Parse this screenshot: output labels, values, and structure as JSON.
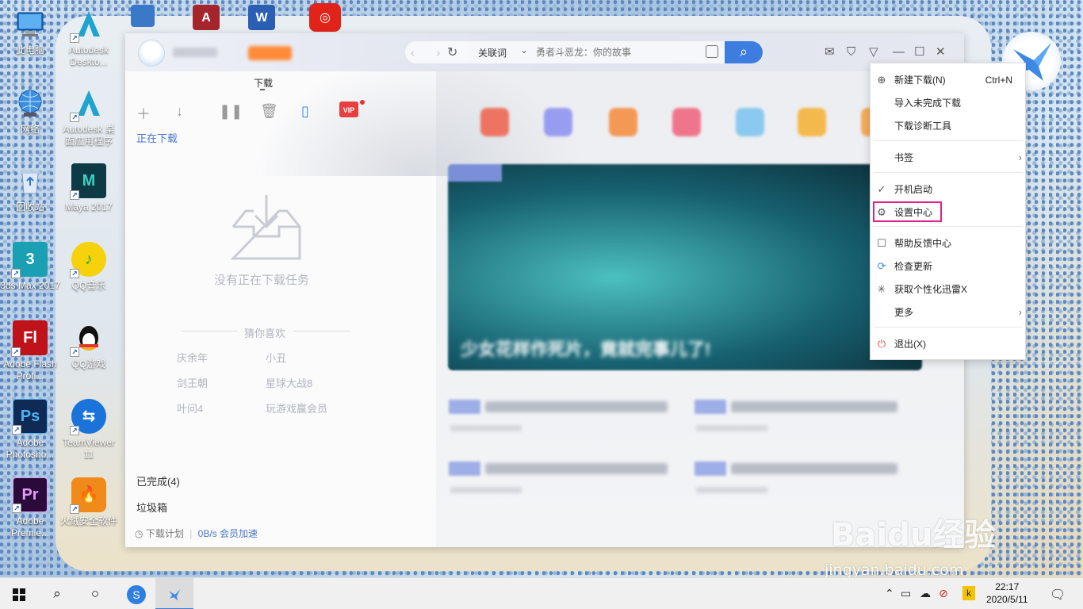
{
  "desktop": {
    "icons": [
      {
        "label": "此电脑",
        "icon": "computer-icon",
        "color": "#3c8ad8"
      },
      {
        "label": "Autodesk Deskto...",
        "icon": "autodesk-icon",
        "color": "#1f8fc0"
      },
      {
        "label": "网络",
        "icon": "network-icon",
        "color": "#3c8ad8"
      },
      {
        "label": "Autodesk 桌面应用程序",
        "icon": "autodesk-icon",
        "color": "#1f8fc0"
      },
      {
        "label": "回收站",
        "icon": "recycle-bin-icon",
        "color": "#6aa0d8"
      },
      {
        "label": "Maya 2017",
        "icon": "maya-icon",
        "color": "#2aa9a0"
      },
      {
        "label": "3ds Max 2017",
        "icon": "3dsmax-icon",
        "color": "#1a9ab0"
      },
      {
        "label": "QQ音乐",
        "icon": "qq-music-icon",
        "color": "#f5d20b"
      },
      {
        "label": "Adobe Flash Profi...",
        "icon": "flash-icon",
        "color": "#c0121a"
      },
      {
        "label": "QQ游戏",
        "icon": "qq-game-icon",
        "color": "#e03a2a"
      },
      {
        "label": "Adobe Photosho...",
        "icon": "photoshop-icon",
        "color": "#1a4f9a"
      },
      {
        "label": "TeamViewer 11",
        "icon": "teamviewer-icon",
        "color": "#1a73d8"
      },
      {
        "label": "Adobe Premie...",
        "icon": "premiere-icon",
        "color": "#5a1a78"
      },
      {
        "label": "火绒安全软件",
        "icon": "huorong-icon",
        "color": "#f08a1a"
      }
    ],
    "top_icons": [
      "word-icon",
      "access-icon",
      "netease-music-icon",
      "network-share-icon"
    ]
  },
  "app": {
    "search_keyword_mode": "关联词",
    "search_placeholder": "勇者斗恶龙：你的故事",
    "download_tab": "下载",
    "downloading": "正在下载",
    "empty_text": "没有正在下载任务",
    "guess_title": "猜你喜欢",
    "suggestions": [
      "庆余年",
      "小丑",
      "剑王朝",
      "星球大战8",
      "叶问4",
      "玩游戏赢会员"
    ],
    "completed": "已完成(4)",
    "trash": "垃圾箱",
    "footer": {
      "plan": "下载计划",
      "speed": "0B/s",
      "boost": "会员加速"
    },
    "vip_badge": "VIP",
    "banner_title": "少女花样作死片，竟就完事儿了!"
  },
  "menu": {
    "items": [
      {
        "label": "新建下载(N)",
        "shortcut": "Ctrl+N",
        "icon": "new-download-icon"
      },
      {
        "label": "导入未完成下载",
        "icon": ""
      },
      {
        "label": "下载诊断工具",
        "icon": ""
      },
      {
        "label": "书签",
        "icon": "",
        "submenu": true
      },
      {
        "label": "开机启动",
        "icon": "checkmark-icon"
      },
      {
        "label": "设置中心",
        "icon": "gear-icon"
      },
      {
        "label": "帮助反馈中心",
        "icon": "feedback-icon"
      },
      {
        "label": "检查更新",
        "icon": "update-icon"
      },
      {
        "label": "获取个性化迅雷X",
        "icon": "sparkle-icon"
      },
      {
        "label": "更多",
        "icon": "",
        "submenu": true
      },
      {
        "label": "退出(X)",
        "icon": "power-icon"
      }
    ],
    "highlight_color": "#e0208a"
  },
  "watermark": {
    "text": "Baidu经验",
    "url": "jingyan.baidu.com"
  },
  "taskbar": {
    "time": "22:17",
    "date": "2020/5/11",
    "tray_app_label": "k"
  }
}
